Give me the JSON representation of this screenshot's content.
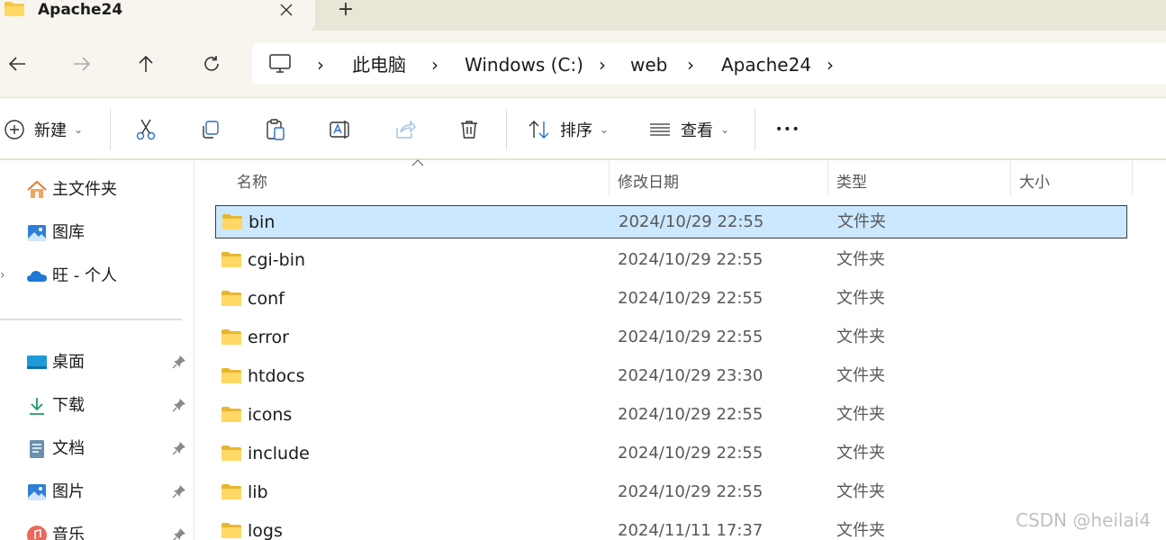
{
  "window": {
    "tab_title": "Apache24",
    "tab_close_icon": "close-icon",
    "new_tab_symbol": "+"
  },
  "nav": {
    "back_icon": "arrow-left-icon",
    "forward_icon": "arrow-right-icon",
    "up_icon": "arrow-up-icon",
    "refresh_icon": "refresh-icon"
  },
  "breadcrumb": {
    "root_icon": "computer-icon",
    "separator": "›",
    "items": [
      "此电脑",
      "Windows (C:)",
      "web",
      "Apache24"
    ]
  },
  "toolbar": {
    "new_label": "新建",
    "sort_label": "排序",
    "view_label": "查看",
    "more_symbol": "•••",
    "caret": "⌄",
    "icons": [
      "cut-icon",
      "copy-icon",
      "paste-icon",
      "rename-icon",
      "share-icon",
      "delete-icon"
    ]
  },
  "sidebar": {
    "items": [
      {
        "label": "主文件夹",
        "icon": "home-icon"
      },
      {
        "label": "图库",
        "icon": "gallery-icon"
      },
      {
        "label": "旺 - 个人",
        "icon": "onedrive-icon"
      },
      {
        "label": "桌面",
        "icon": "desktop-icon"
      },
      {
        "label": "下载",
        "icon": "download-icon"
      },
      {
        "label": "文档",
        "icon": "document-icon"
      },
      {
        "label": "图片",
        "icon": "pictures-icon"
      },
      {
        "label": "音乐",
        "icon": "music-icon"
      }
    ],
    "expander": "›"
  },
  "columns": {
    "name": "名称",
    "modified": "修改日期",
    "type": "类型",
    "size": "大小"
  },
  "files": [
    {
      "name": "bin",
      "modified": "2024/10/29 22:55",
      "type": "文件夹",
      "selected": true
    },
    {
      "name": "cgi-bin",
      "modified": "2024/10/29 22:55",
      "type": "文件夹"
    },
    {
      "name": "conf",
      "modified": "2024/10/29 22:55",
      "type": "文件夹"
    },
    {
      "name": "error",
      "modified": "2024/10/29 22:55",
      "type": "文件夹"
    },
    {
      "name": "htdocs",
      "modified": "2024/10/29 23:30",
      "type": "文件夹"
    },
    {
      "name": "icons",
      "modified": "2024/10/29 22:55",
      "type": "文件夹"
    },
    {
      "name": "include",
      "modified": "2024/10/29 22:55",
      "type": "文件夹"
    },
    {
      "name": "lib",
      "modified": "2024/10/29 22:55",
      "type": "文件夹"
    },
    {
      "name": "logs",
      "modified": "2024/11/11 17:37",
      "type": "文件夹"
    }
  ],
  "watermark": "CSDN @heilai4",
  "colors": {
    "selection": "#cce8ff",
    "folder": "#f4c64a",
    "chrome": "#f7f5ed"
  }
}
